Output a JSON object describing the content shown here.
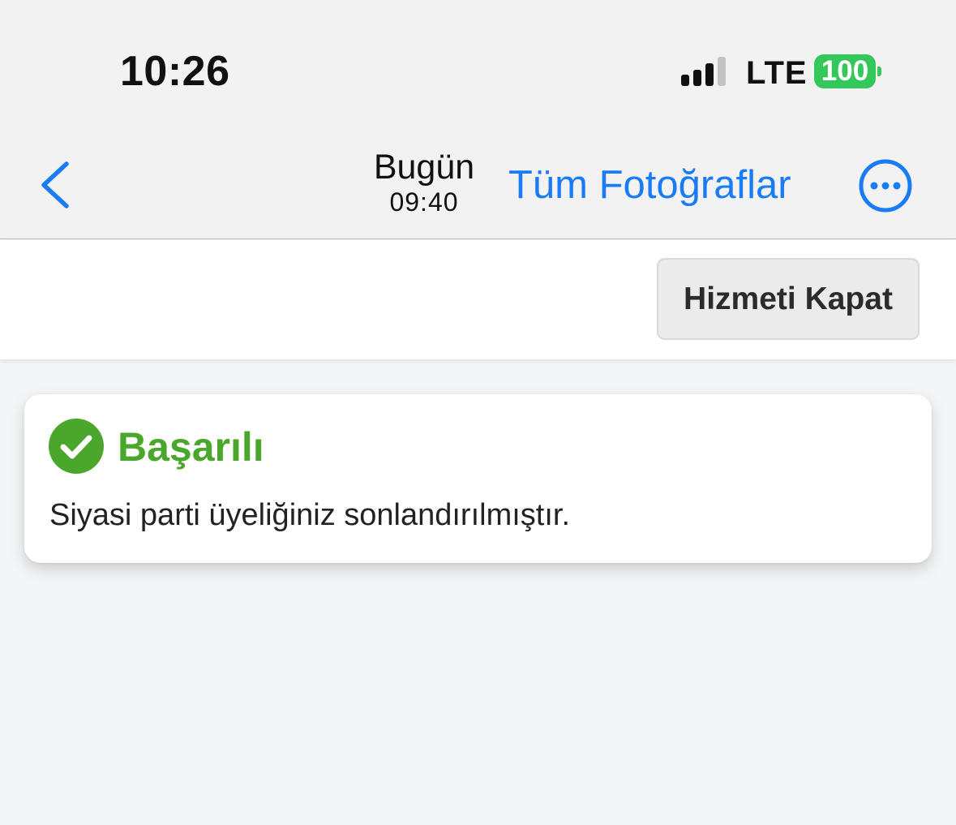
{
  "status_bar": {
    "time": "10:26",
    "network": "LTE",
    "battery": "100",
    "signal_bars_active": 3,
    "signal_bars_total": 4
  },
  "nav_bar": {
    "back_icon": "chevron-left-icon",
    "title_day": "Bugün",
    "title_time": "09:40",
    "all_photos_label": "Tüm Fotoğraflar",
    "more_icon": "ellipsis-circle-icon"
  },
  "toolbar": {
    "close_service_label": "Hizmeti Kapat"
  },
  "alert": {
    "icon": "check-circle-icon",
    "title": "Başarılı",
    "message": "Siyasi parti üyeliğiniz sonlandırılmıştır."
  },
  "colors": {
    "accent_blue": "#1a7cf4",
    "success_green": "#4aa72b",
    "battery_green": "#34c759"
  }
}
